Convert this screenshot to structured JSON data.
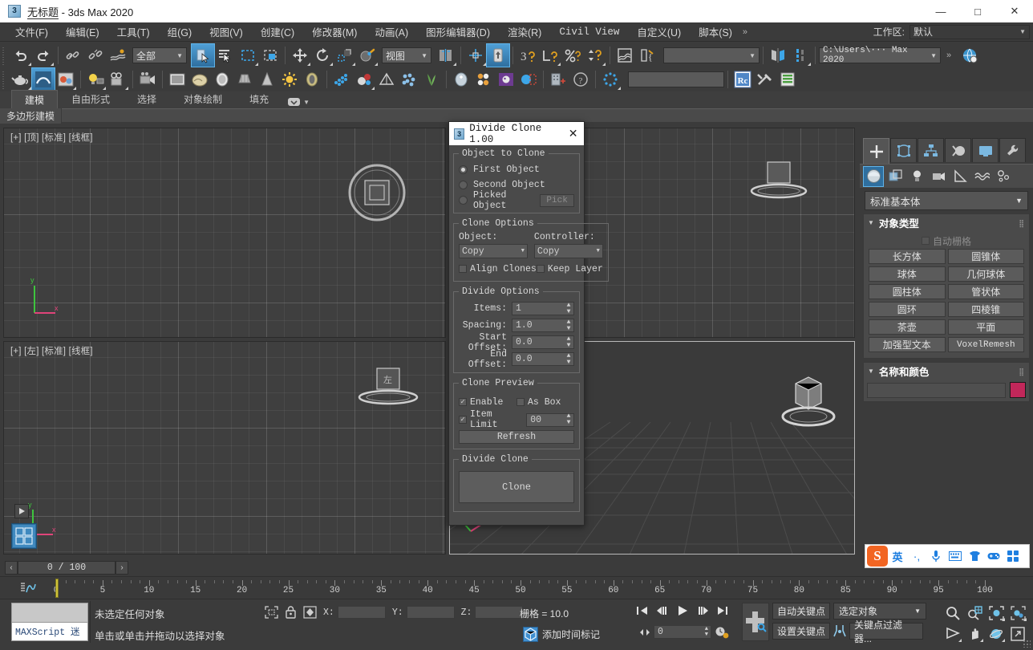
{
  "titlebar": {
    "doc_name": "无标题",
    "app_name": "- 3ds Max 2020",
    "icon": "max-logo-icon",
    "minimize": "—",
    "maximize": "□",
    "close": "✕"
  },
  "menubar": {
    "items": [
      {
        "label": "文件(F)"
      },
      {
        "label": "编辑(E)"
      },
      {
        "label": "工具(T)"
      },
      {
        "label": "组(G)"
      },
      {
        "label": "视图(V)"
      },
      {
        "label": "创建(C)"
      },
      {
        "label": "修改器(M)"
      },
      {
        "label": "动画(A)"
      },
      {
        "label": "图形编辑器(D)"
      },
      {
        "label": "渲染(R)"
      },
      {
        "label": "Civil View"
      },
      {
        "label": "自定义(U)"
      },
      {
        "label": "脚本(S)"
      }
    ],
    "overflow": "»",
    "workspace_label": "工作区:",
    "workspace_value": "默认"
  },
  "toolbar": {
    "selection_filter": "全部",
    "reference_coord": "视图",
    "named_selection_placeholder": "",
    "project_folder": "C:\\Users\\··· Max 2020",
    "overflow": "»",
    "render_preset_placeholder": ""
  },
  "ribbon": {
    "tabs": [
      {
        "label": "建模",
        "active": true
      },
      {
        "label": "自由形式",
        "active": false
      },
      {
        "label": "选择",
        "active": false
      },
      {
        "label": "对象绘制",
        "active": false
      },
      {
        "label": "填充",
        "active": false
      }
    ],
    "subrow_label": "多边形建模"
  },
  "viewports": [
    {
      "label": "[+] [顶] [标准] [线框]",
      "name": "viewport-top"
    },
    {
      "label": "",
      "name": "viewport-front"
    },
    {
      "label": "[+] [左] [标准] [线框]",
      "name": "viewport-left"
    },
    {
      "label": "",
      "name": "viewport-perspective"
    }
  ],
  "dialog": {
    "title": "Divide Clone 1.00",
    "icon": "max-logo-icon",
    "close": "✕",
    "groups": {
      "object_to_clone": {
        "legend": "Object to Clone",
        "options": [
          {
            "label": "First Object",
            "selected": true
          },
          {
            "label": "Second Object",
            "selected": false
          },
          {
            "label": "Picked Object",
            "selected": false
          }
        ],
        "pick_button": "Pick"
      },
      "clone_options": {
        "legend": "Clone Options",
        "object_label": "Object:",
        "object_value": "Copy",
        "controller_label": "Controller:",
        "controller_value": "Copy",
        "align_clones": {
          "label": "Align Clones",
          "checked": false
        },
        "keep_layer": {
          "label": "Keep Layer",
          "checked": false
        }
      },
      "divide_options": {
        "legend": "Divide Options",
        "fields": [
          {
            "label": "Items:",
            "value": "1"
          },
          {
            "label": "Spacing:",
            "value": "1.0"
          },
          {
            "label": "Start Offset:",
            "value": "0.0"
          },
          {
            "label": "End Offset:",
            "value": "0.0"
          }
        ]
      },
      "clone_preview": {
        "legend": "Clone Preview",
        "enable": {
          "label": "Enable",
          "checked": true
        },
        "as_box": {
          "label": "As Box",
          "checked": false
        },
        "item_limit": {
          "label": "Item Limit",
          "checked": true,
          "value": "00"
        },
        "refresh_button": "Refresh"
      },
      "divide_clone": {
        "legend": "Divide Clone",
        "clone_button": "Clone"
      }
    }
  },
  "command_panel": {
    "tabs": [
      {
        "name": "create-tab",
        "icon": "plus-icon",
        "active": true
      },
      {
        "name": "modify-tab",
        "icon": "modify-icon",
        "active": false
      },
      {
        "name": "hierarchy-tab",
        "icon": "hierarchy-icon",
        "active": false
      },
      {
        "name": "motion-tab",
        "icon": "motion-icon",
        "active": false
      },
      {
        "name": "display-tab",
        "icon": "display-icon",
        "active": false
      },
      {
        "name": "utilities-tab",
        "icon": "wrench-icon",
        "active": false
      }
    ],
    "category_buttons": [
      {
        "name": "geometry-icon",
        "active": true
      },
      {
        "name": "shapes-icon",
        "active": false
      },
      {
        "name": "lights-icon",
        "active": false
      },
      {
        "name": "cameras-icon",
        "active": false
      },
      {
        "name": "helpers-icon",
        "active": false
      },
      {
        "name": "space-warps-icon",
        "active": false
      },
      {
        "name": "systems-icon",
        "active": false
      }
    ],
    "category_combo": "标准基本体",
    "rollouts": [
      {
        "title": "对象类型",
        "autogrid_label": "自动栅格",
        "autogrid_checked": false,
        "buttons": [
          "长方体",
          "圆锥体",
          "球体",
          "几何球体",
          "圆柱体",
          "管状体",
          "圆环",
          "四棱锥",
          "茶壶",
          "平面",
          "加强型文本",
          "VoxelRemesh"
        ]
      },
      {
        "title": "名称和颜色",
        "name_value": "",
        "color": "#c2275a"
      }
    ]
  },
  "timeline": {
    "prev_frame": "‹",
    "frame_display": "0 / 100",
    "next_frame": "›",
    "ticks": [
      0,
      5,
      10,
      15,
      20,
      25,
      30,
      35,
      40,
      45,
      50,
      55,
      60,
      65,
      70,
      75,
      80,
      85,
      90,
      95,
      100
    ],
    "playhead_frame": 0
  },
  "statusbar": {
    "maxscript_label": "MAXScript 迷",
    "selection_status": "未选定任何对象",
    "prompt": "单击或单击并拖动以选择对象",
    "coords": [
      {
        "label": "X:",
        "value": ""
      },
      {
        "label": "Y:",
        "value": ""
      },
      {
        "label": "Z:",
        "value": ""
      }
    ],
    "grid_text": "栅格 = 10.0",
    "add_time_tag": "添加时间标记",
    "auto_key": "自动关键点",
    "set_key": "设置关键点",
    "key_filter_combo": "选定对象",
    "key_filters": "关键点过滤器...",
    "current_time": "0"
  },
  "ime": {
    "logo": "S",
    "mode": "英",
    "items": [
      "voice-icon",
      "keyboard-icon",
      "skin-icon",
      "game-icon",
      "apps-icon"
    ]
  },
  "colors": {
    "accent_blue": "#2f6f9f",
    "panel_bg": "#3b3b3b",
    "viewport_bg": "#3f3f3f",
    "object_color": "#c2275a"
  }
}
